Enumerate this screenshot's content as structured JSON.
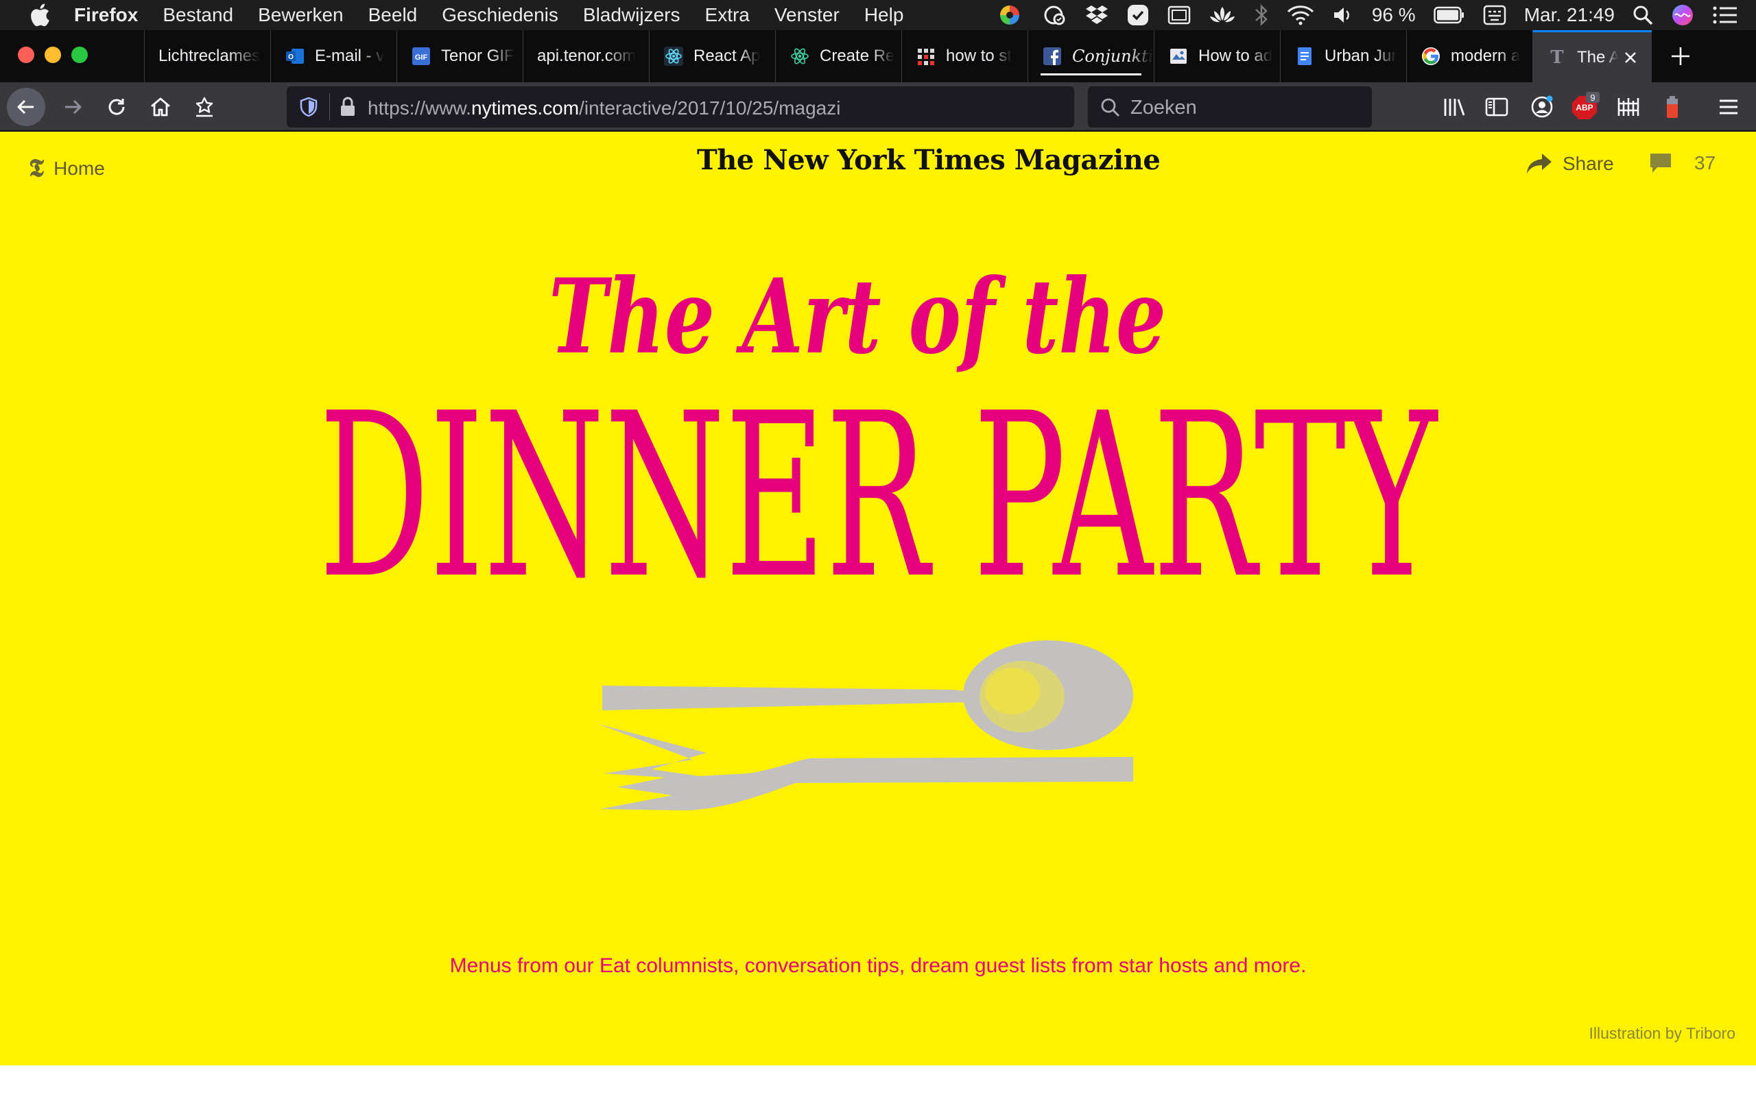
{
  "menubar": {
    "app_name": "Firefox",
    "items": [
      "Bestand",
      "Bewerken",
      "Beeld",
      "Geschiedenis",
      "Bladwijzers",
      "Extra",
      "Venster",
      "Help"
    ],
    "battery_percent": "96 %",
    "clock": "Mar. 21:49"
  },
  "tabs": [
    {
      "title": "Lichtreclames",
      "icon": "generic-page-icon"
    },
    {
      "title": "E-mail - v",
      "icon": "outlook-icon"
    },
    {
      "title": "Tenor GIF",
      "icon": "gif-icon"
    },
    {
      "title": "api.tenor.com",
      "icon": "none"
    },
    {
      "title": "React Ap",
      "icon": "react-icon"
    },
    {
      "title": "Create Re",
      "icon": "react-icon"
    },
    {
      "title": "how to st",
      "icon": "grid-icon"
    },
    {
      "title": "Conjunkti",
      "icon": "facebook-icon"
    },
    {
      "title": "How to ad",
      "icon": "page-icon"
    },
    {
      "title": "Urban Jur",
      "icon": "docs-icon"
    },
    {
      "title": "modern a",
      "icon": "google-icon"
    },
    {
      "title": "The A",
      "icon": "nyt-icon",
      "active": true
    }
  ],
  "navbar": {
    "url_prefix": "https://www.",
    "url_domain": "nytimes.com",
    "url_path": "/interactive/2017/10/25/magazi",
    "search_placeholder": "Zoeken",
    "adblock_count": "9"
  },
  "page": {
    "home_label": "Home",
    "masthead": "The New York Times Magazine",
    "share_label": "Share",
    "comment_count": "37",
    "hero_script": "The Art of the",
    "hero_main": "DINNER PARTY",
    "dek": "Menus from our Eat columnists, conversation tips, dream guest lists from star hosts and more.",
    "credit": "Illustration by Triboro"
  },
  "colors": {
    "page_background": "#fff200",
    "hero_magenta": "#e6007e",
    "cutlery_gray": "#c2c1c0"
  }
}
